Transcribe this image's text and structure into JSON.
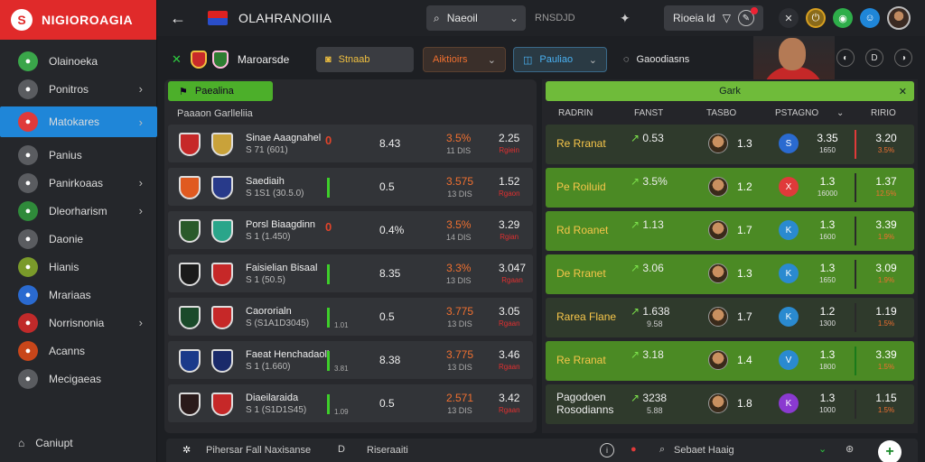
{
  "brand": {
    "name": "NIGIOROAGIA",
    "logo_letter": "S"
  },
  "sidebar": {
    "items": [
      {
        "label": "Olainoeka",
        "icon": "window-icon",
        "color": "#3aa64a",
        "chevron": false
      },
      {
        "label": "Ponitros",
        "icon": "tag-icon",
        "color": "#5a5c60",
        "chevron": true
      },
      {
        "label": "Matokares",
        "icon": "shield-icon",
        "color": "#e03a3a",
        "chevron": true,
        "active": true
      },
      {
        "label": "Panius",
        "icon": "link-icon",
        "color": "#5a5c60",
        "chevron": false
      },
      {
        "label": "Panirkoaas",
        "icon": "flag-icon",
        "color": "#5a5c60",
        "chevron": true
      },
      {
        "label": "Dleorharism",
        "icon": "ball-icon",
        "color": "#2f8a3a",
        "chevron": true
      },
      {
        "label": "Daonie",
        "icon": "calendar-icon",
        "color": "#5a5c60",
        "chevron": false
      },
      {
        "label": "Hianis",
        "icon": "crest-icon",
        "color": "#7a9a2a",
        "chevron": false
      },
      {
        "label": "Mrariaas",
        "icon": "grid-icon",
        "color": "#2a6ad0",
        "chevron": false
      },
      {
        "label": "Norrisnonia",
        "icon": "pen-icon",
        "color": "#c02a2a",
        "chevron": true
      },
      {
        "label": "Acanns",
        "icon": "user-icon",
        "color": "#c8461a",
        "chevron": false
      },
      {
        "label": "Mecigaeas",
        "icon": "shield-icon",
        "color": "#5a5c60",
        "chevron": false
      }
    ],
    "bottom_label": "Caniupt"
  },
  "topbar": {
    "title": "OLAHRANOIIIA",
    "search_value": "Naeoil",
    "search_text": "RNSDJD",
    "filter_label": "Rioeia ld",
    "icons": [
      "pin-icon",
      "x-icon",
      "power-icon",
      "gamepad-icon",
      "user-circle-icon"
    ]
  },
  "subbar": {
    "label": "Maroarsde",
    "pill1": "Stnaab",
    "pill2": "Aiktioirs",
    "pill3": "Pauliao",
    "text": "Gaoodiasns"
  },
  "left_panel": {
    "header": "Paealina",
    "subheader": "Paaaon Garlleliia",
    "rows": [
      {
        "line1": "Sinae Aaagnahel",
        "line2": "S 71 (601)",
        "ind": "0",
        "v1": "8.43",
        "v2": "3.5%",
        "v2s": "11 DIS",
        "v3": "2.25",
        "v3s": "Rgiein",
        "home": "#c62828",
        "away": "#c9a23a"
      },
      {
        "line1": "Saediaih",
        "line2": "S 1S1 (30.5.0)",
        "ind": "",
        "v1": "0.5",
        "v2": "3.575",
        "v2s": "13 DIS",
        "v3": "1.52",
        "v3s": "Rgaon",
        "home": "#e05a20",
        "away": "#283a8a"
      },
      {
        "line1": "Porsl Biaagdinn",
        "line2": "S 1 (1.450)",
        "ind": "0",
        "v1": "0.4%",
        "v2": "3.5%",
        "v2s": "14 DIS",
        "v3": "3.29",
        "v3s": "Rgian",
        "home": "#2a5a2a",
        "away": "#2aa58a"
      },
      {
        "line1": "Faisielian Bisaal",
        "line2": "S 1 (50.5)",
        "ind": "",
        "v1": "8.35",
        "v2": "3.3%",
        "v2s": "13 DIS",
        "v3": "3.047",
        "v3s": "Rgaan",
        "home": "#1a1a1a",
        "away": "#c62828"
      },
      {
        "line1": "Caororialn",
        "line2": "S (S1A1D3045)",
        "ind": "",
        "v1": "0.5",
        "v2": "3.775",
        "v2s": "13 DIS",
        "v3": "3.05",
        "v3s": "Rgaan",
        "home": "#1a4a2a",
        "away": "#c62828",
        "small": "1.01"
      },
      {
        "line1": "Faeat Henchadaoli",
        "line2": "S 1 (1.660)",
        "ind": "",
        "v1": "8.38",
        "v2": "3.775",
        "v2s": "13 DIS",
        "v3": "3.46",
        "v3s": "Rgaan",
        "home": "#1a3a8a",
        "away": "#1a2a6a",
        "small": "3.81"
      },
      {
        "line1": "Diaeilaraida",
        "line2": "S 1 (S1D1S45)",
        "ind": "",
        "v1": "0.5",
        "v2": "2.571",
        "v2s": "13 DIS",
        "v3": "3.42",
        "v3s": "Rgaan",
        "home": "#2a1a1a",
        "away": "#c62828",
        "small": "1.09"
      }
    ]
  },
  "right_panel": {
    "header": "Gark",
    "columns": [
      "RADRIN",
      "FANST",
      "TASBO",
      "PSTAGNO",
      "RIRIO"
    ],
    "rows": [
      {
        "name": "Re Rranat",
        "two": false,
        "trend": "0.53",
        "trend_sub": "",
        "v1": "1.3",
        "v2": "3.35",
        "v2s": "1650",
        "v3": "3.20",
        "v3s": "3.5%",
        "badge_color": "#2a6ad0",
        "badge": "S",
        "style": "dark",
        "sep": "#e03a3a"
      },
      {
        "name": "Pe Roiluid",
        "two": false,
        "trend": "3.5%",
        "trend_sub": "",
        "v1": "1.2",
        "v2": "1.3",
        "v2s": "16000",
        "v3": "1.37",
        "v3s": "12.5%",
        "badge_color": "#e03a3a",
        "badge": "X",
        "style": "green",
        "sep": "#2a2a2a"
      },
      {
        "name": "Rd Roanet",
        "two": false,
        "trend": "1.13",
        "trend_sub": "",
        "v1": "1.7",
        "v2": "1.3",
        "v2s": "1600",
        "v3": "3.39",
        "v3s": "1.9%",
        "badge_color": "#2a8ad0",
        "badge": "K",
        "style": "green",
        "sep": "#2a2a2a"
      },
      {
        "name": "De Rranet",
        "two": false,
        "trend": "3.06",
        "trend_sub": "",
        "v1": "1.3",
        "v2": "1.3",
        "v2s": "1650",
        "v3": "3.09",
        "v3s": "1.9%",
        "badge_color": "#2a8ad0",
        "badge": "K",
        "style": "green",
        "sep": "#2a2a2a"
      },
      {
        "name": "Rarea Flane",
        "two": false,
        "trend": "1.638",
        "trend_sub": "9.58",
        "v1": "1.7",
        "v2": "1.2",
        "v2s": "1300",
        "v3": "1.19",
        "v3s": "1.5%",
        "badge_color": "#2a8ad0",
        "badge": "K",
        "style": "dark",
        "sep": "#2a2a2a"
      },
      {
        "name": "Re Rranat",
        "two": false,
        "trend": "3.18",
        "trend_sub": "",
        "v1": "1.4",
        "v2": "1.3",
        "v2s": "1800",
        "v3": "3.39",
        "v3s": "1.5%",
        "badge_color": "#2a8ad0",
        "badge": "V",
        "style": "green",
        "sep": "#1a7a1a"
      },
      {
        "name": "Pagodoen",
        "name2": "Rosodianns",
        "two": true,
        "trend": "3238",
        "trend_sub": "5.88",
        "v1": "1.8",
        "v2": "1.3",
        "v2s": "1000",
        "v3": "1.15",
        "v3s": "1.5%",
        "badge_color": "#8a3ad0",
        "badge": "K",
        "style": "dark",
        "sep": "#2a2a2a"
      }
    ]
  },
  "bottombar": {
    "text1": "Pihersar Fall Naxisanse",
    "text2": "Riseraaiti",
    "text3": "Sebaet Haaig"
  }
}
